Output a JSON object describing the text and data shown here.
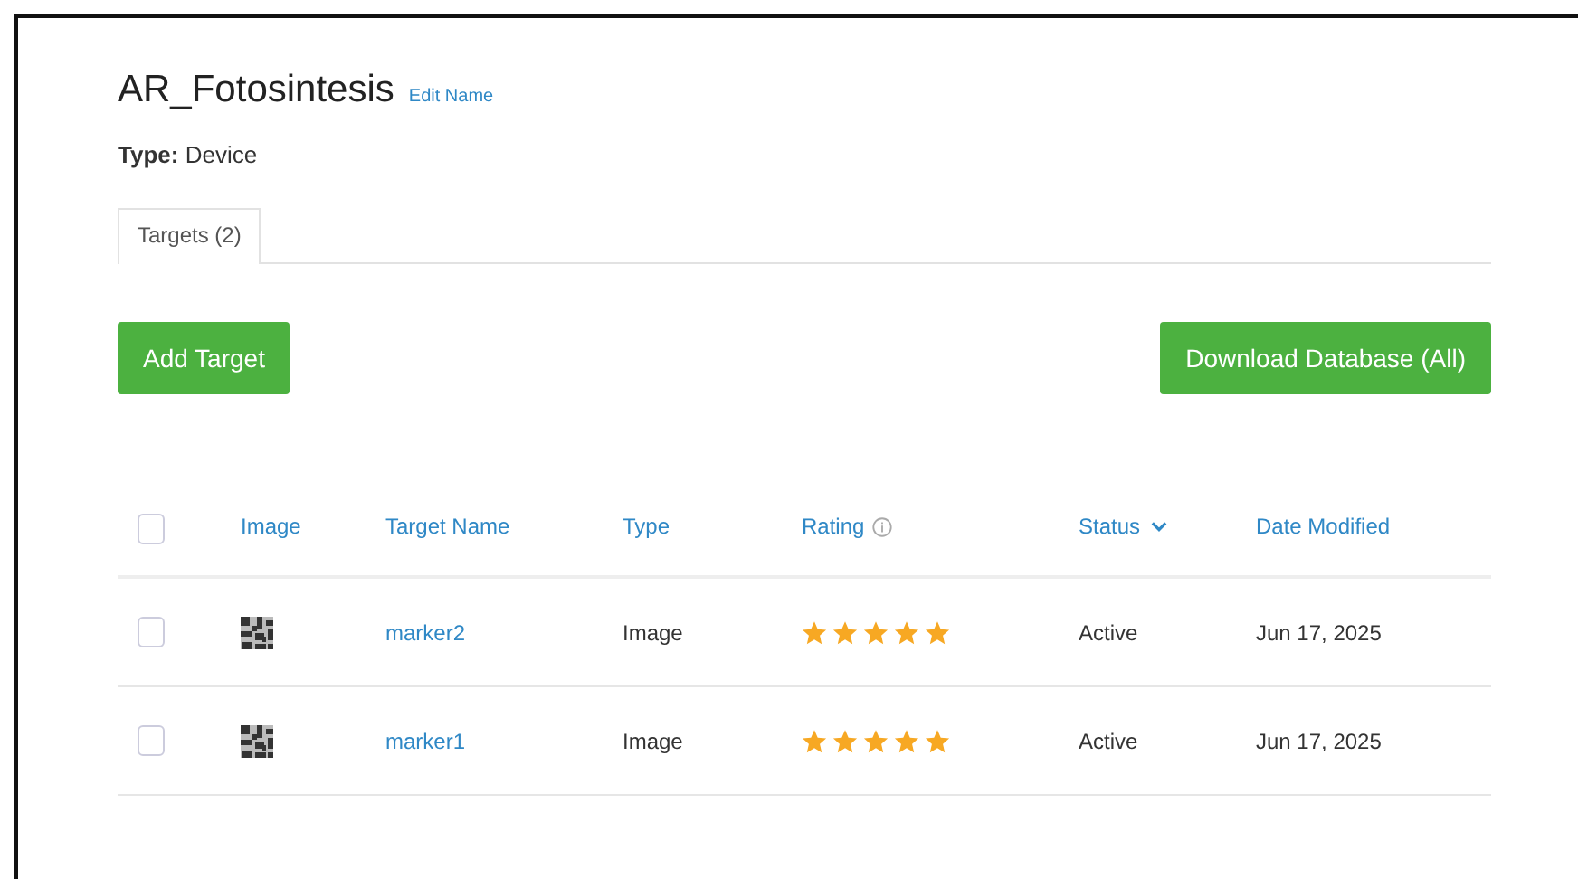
{
  "title": "AR_Fotosintesis",
  "edit_link": "Edit Name",
  "type_label": "Type:",
  "type_value": "Device",
  "tabs": [
    {
      "label": "Targets (2)",
      "selected": true
    }
  ],
  "buttons": {
    "add": "Add Target",
    "download": "Download Database (All)"
  },
  "table": {
    "select_all": false,
    "columns": [
      "Image",
      "Target Name",
      "Type",
      "Rating",
      "Status",
      "Date Modified"
    ],
    "rows": [
      {
        "checked": false,
        "name": "marker2",
        "type": "Image",
        "stars": 5,
        "status": "Active",
        "date": "Jun 17, 2025"
      },
      {
        "checked": false,
        "name": "marker1",
        "type": "Image",
        "stars": 5,
        "status": "Active",
        "date": "Jun 17, 2025"
      }
    ]
  }
}
